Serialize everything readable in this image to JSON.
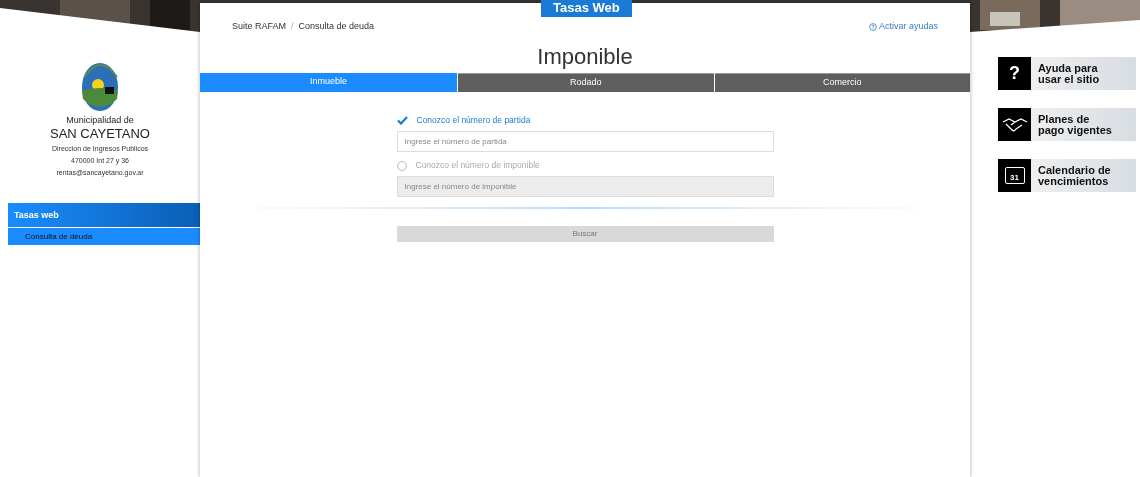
{
  "header": {
    "badge": "Tasas Web"
  },
  "org": {
    "prefix": "Municipalidad de",
    "name": "SAN CAYETANO",
    "lines": [
      "Direccion de Ingresos Publicos",
      "470000 Int 27 y 36",
      "rentas@sancayetano.gov.ar"
    ]
  },
  "sidebar": {
    "items": [
      {
        "label": "Tasas web",
        "selected": false,
        "children": [
          {
            "label": "Consulta de deuda",
            "selected": true
          }
        ]
      }
    ]
  },
  "breadcrumb": [
    "Suite RAFAM",
    "Consulta de deuda"
  ],
  "breadcrumb_separator": "/",
  "help_link": "Activar ayudas",
  "heading": "Imponible",
  "tabs": [
    {
      "label": "Inmueble",
      "selected": true
    },
    {
      "label": "Rodado",
      "selected": false
    },
    {
      "label": "Comercio",
      "selected": false
    }
  ],
  "options": [
    {
      "label": "Conozco el número de partida",
      "selected": true,
      "placeholder": "Ingrese el número de partida"
    },
    {
      "label": "Conozco el número de imponible",
      "selected": false,
      "placeholder": "Ingrese el número de imponible"
    }
  ],
  "search_button": {
    "label": "Buscar",
    "disabled": true
  },
  "banners": [
    {
      "kind": "help",
      "lines": [
        "Ayuda para",
        "usar el sitio"
      ],
      "icon_text": "?"
    },
    {
      "kind": "handshake",
      "lines": [
        "Planes de",
        "pago vigentes"
      ]
    },
    {
      "kind": "calendar",
      "lines": [
        "Calendario de",
        "vencimientos"
      ],
      "icon_text": "31"
    }
  ]
}
